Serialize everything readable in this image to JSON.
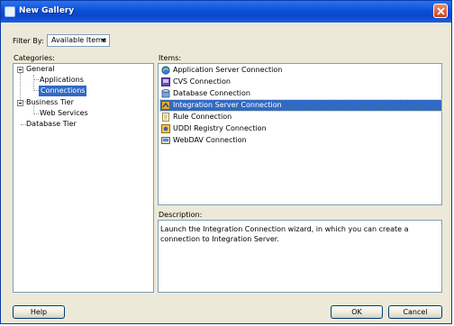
{
  "window": {
    "title": "New Gallery"
  },
  "filter": {
    "label": "Filter By:",
    "selected": "Available Items"
  },
  "categories": {
    "label": "Categories:",
    "nodes": {
      "general": "General",
      "applications": "Applications",
      "connections": "Connections",
      "business_tier": "Business Tier",
      "web_services": "Web Services",
      "database_tier": "Database Tier"
    }
  },
  "items": {
    "label": "Items:",
    "list": [
      {
        "label": "Application Server Connection",
        "icon": "server-connection-icon"
      },
      {
        "label": "CVS Connection",
        "icon": "cvs-icon"
      },
      {
        "label": "Database Connection",
        "icon": "database-icon"
      },
      {
        "label": "Integration Server Connection",
        "icon": "integration-server-icon"
      },
      {
        "label": "Rule Connection",
        "icon": "rule-icon"
      },
      {
        "label": "UDDI Registry Connection",
        "icon": "uddi-registry-icon"
      },
      {
        "label": "WebDAV Connection",
        "icon": "webdav-icon"
      }
    ]
  },
  "description": {
    "label": "Description:",
    "text": "Launch the Integration Connection wizard, in which you can create a connection to Integration Server."
  },
  "buttons": {
    "help": "Help",
    "ok": "OK",
    "cancel": "Cancel"
  },
  "colors": {
    "selection": "#316ac5",
    "titlebar": "#0b4fd8",
    "dialog_bg": "#ece9d8"
  }
}
